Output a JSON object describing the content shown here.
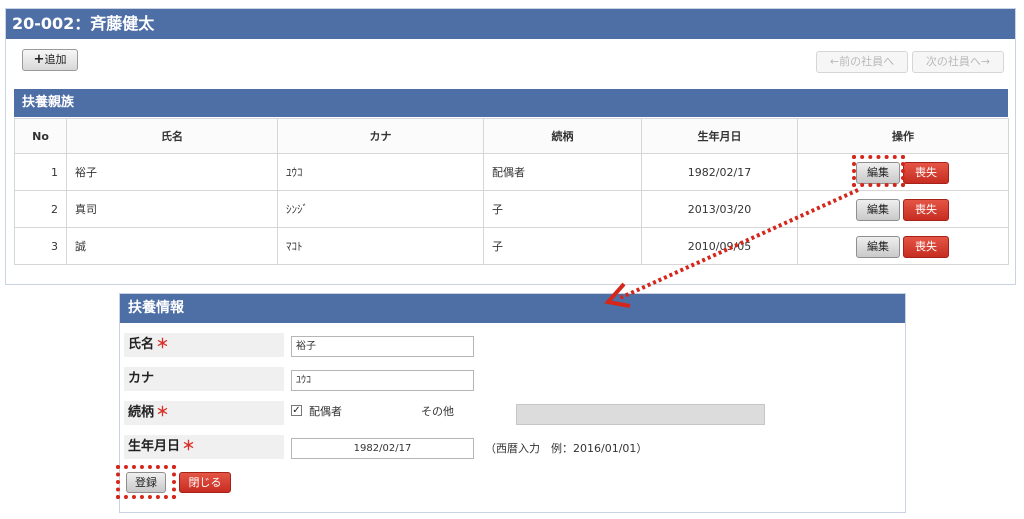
{
  "header": {
    "title": "20-002：斉藤健太"
  },
  "toolbar": {
    "add_label": "追加",
    "prev_label": "←前の社員へ",
    "next_label": "次の社員へ→"
  },
  "dependents": {
    "title": "扶養親族",
    "columns": [
      "No",
      "氏名",
      "カナ",
      "続柄",
      "生年月日",
      "操作"
    ],
    "rows": [
      {
        "no": "1",
        "name": "裕子",
        "kana": "ﾕｳｺ",
        "relation": "配偶者",
        "birth": "1982/02/17"
      },
      {
        "no": "2",
        "name": "真司",
        "kana": "ｼﾝｼﾞ",
        "relation": "子",
        "birth": "2013/03/20"
      },
      {
        "no": "3",
        "name": "誠",
        "kana": "ﾏｺﾄ",
        "relation": "子",
        "birth": "2010/09/05"
      }
    ],
    "edit_label": "編集",
    "lose_label": "喪失"
  },
  "form": {
    "title": "扶養情報",
    "name_label": "氏名",
    "kana_label": "カナ",
    "relation_label": "続柄",
    "birth_label": "生年月日",
    "required_mark": "＊",
    "name_value": "裕子",
    "kana_value": "ﾕｳｺ",
    "spouse_checkbox_label": "配偶者",
    "spouse_checked": true,
    "other_label": "その他",
    "other_value": "",
    "birth_value": "1982/02/17",
    "birth_hint": "（西暦入力　例：2016/01/01）",
    "save_label": "登録",
    "close_label": "閉じる"
  },
  "colors": {
    "header_blue": "#4e6fa6",
    "danger_red": "#d33a2c",
    "callout_red": "#d5261b"
  }
}
